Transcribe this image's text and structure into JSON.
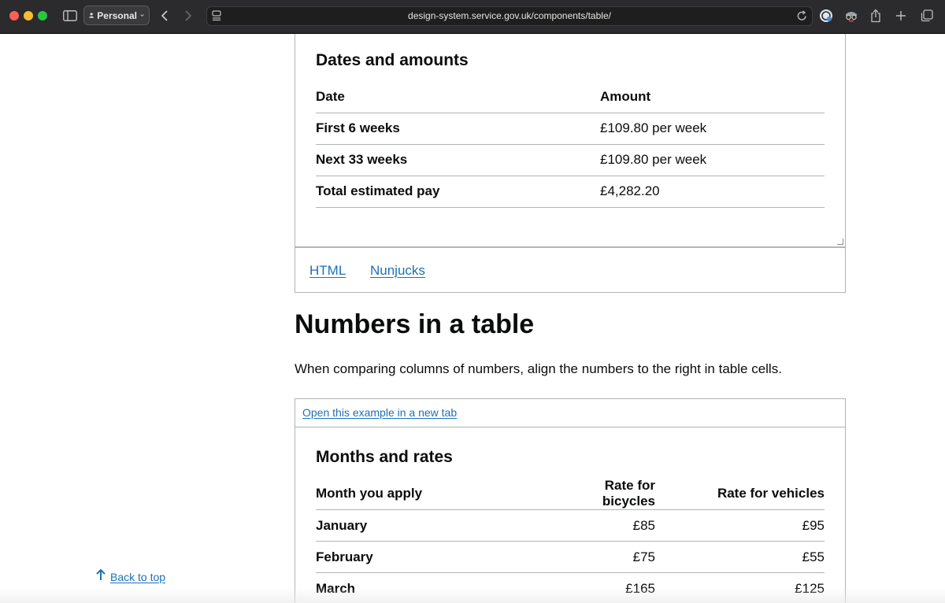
{
  "browser": {
    "profile_label": "Personal",
    "url": "design-system.service.gov.uk/components/table/"
  },
  "example1": {
    "caption": "Dates and amounts",
    "headers": [
      "Date",
      "Amount"
    ],
    "rows": [
      [
        "First 6 weeks",
        "£109.80 per week"
      ],
      [
        "Next 33 weeks",
        "£109.80 per week"
      ],
      [
        "Total estimated pay",
        "£4,282.20"
      ]
    ],
    "tabs": [
      "HTML",
      "Nunjucks"
    ]
  },
  "section": {
    "heading": "Numbers in a table",
    "body": "When comparing columns of numbers, align the numbers to the right in table cells."
  },
  "example2": {
    "open_link": "Open this example in a new tab",
    "caption": "Months and rates",
    "headers": [
      "Month you apply",
      "Rate for bicycles",
      "Rate for vehicles"
    ],
    "rows": [
      [
        "January",
        "£85",
        "£95"
      ],
      [
        "February",
        "£75",
        "£55"
      ],
      [
        "March",
        "£165",
        "£125"
      ]
    ]
  },
  "back_to_top": "Back to top"
}
